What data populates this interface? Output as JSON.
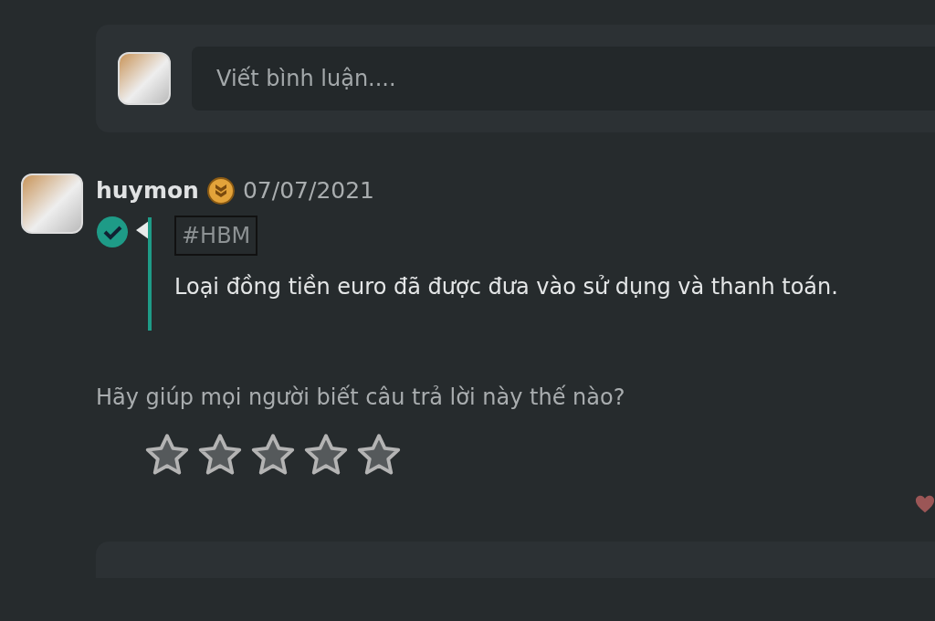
{
  "composer": {
    "placeholder": "Viết bình luận...."
  },
  "comment": {
    "author": "huymon",
    "date": "07/07/2021",
    "verified": true,
    "tag": "#HBM",
    "text": "Loại đồng tiền euro đã được đưa vào sử dụng và thanh toán."
  },
  "rating": {
    "prompt": "Hãy giúp mọi người biết câu trả lời này thế nào?",
    "stars": 0
  }
}
